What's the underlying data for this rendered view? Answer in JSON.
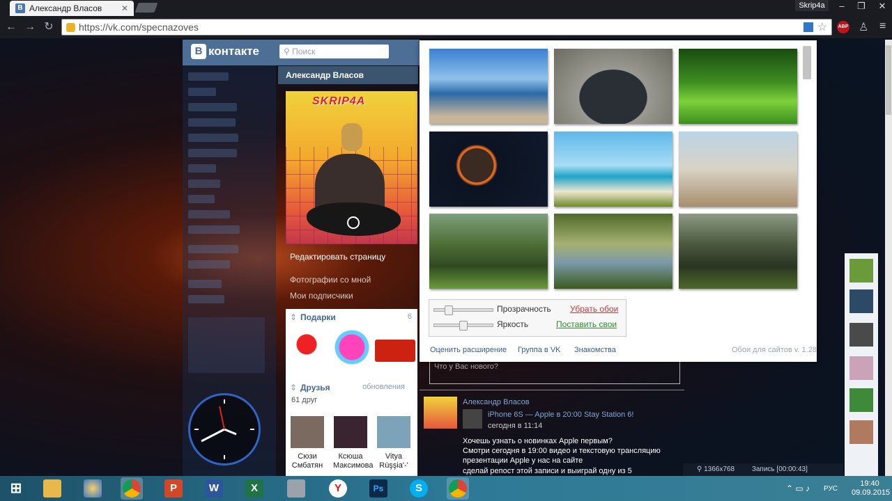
{
  "browser": {
    "tab_title": "Александр Власов",
    "tab_close": "✕",
    "profile_name": "Skrip4a",
    "url": "https://vk.com/specnazoves",
    "abp_label": "ABP",
    "window_controls": [
      "–",
      "❐",
      "✕"
    ]
  },
  "vk": {
    "logo_letter": "В",
    "logo_text": "контакте",
    "search_placeholder": "Поиск",
    "profile_name": "Александр Власов",
    "avatar_watermark": "SKRIP4A",
    "edit_page": "Редактировать страницу",
    "photos_with_me": "Фотографии со мной",
    "subscriptions": "Мои подписчики",
    "gifts": {
      "title": "Подарки",
      "count": "6"
    },
    "friends": {
      "title": "Друзья",
      "updates": "обновления",
      "count_text": "61 друг",
      "list": [
        {
          "first": "Сюзи",
          "last": "Смбатян"
        },
        {
          "first": "Ксюша",
          "last": "Максимова"
        },
        {
          "first": "Vitya",
          "last": "Rùşşia'-'"
        }
      ]
    }
  },
  "popup": {
    "thumbnails": [
      "beach-sea",
      "sports-car",
      "green-park",
      "planet-space",
      "tropical-palm",
      "city-tower",
      "forest-light",
      "forest-lake",
      "forest-dark"
    ],
    "opacity_label": "Прозрачность",
    "brightness_label": "Яркость",
    "opacity_level": 0.2,
    "brightness_level": 0.48,
    "remove_wallpaper": "Убрать обои",
    "set_own": "Поставить свои",
    "rate_extension": "Оценить расширение",
    "vk_group": "Группа в VK",
    "dating": "Знакомства",
    "version": "Обои для сайтов v. 1.28"
  },
  "feed": {
    "author": "Александр Власов",
    "repost_title": "iPhone 6S — Apple в 20:00 Stay Station 6!",
    "time": "сегодня в 11:14",
    "post_question": "Что у Вас нового?",
    "lines": [
      "Хочешь узнать о новинках Apple первым?",
      "Смотри сегодня в 19:00 видео и текстовую трансляцию",
      "презентации Apple у нас на сайте",
      "сделай репост этой записи и выиграй одну из 5"
    ]
  },
  "recorder": {
    "resolution": "1366x768",
    "status": "Запись [00:00:43]"
  },
  "taskbar": {
    "language": "РУС",
    "time": "19:40",
    "date": "09.09.2015",
    "apps": [
      "windows-start",
      "file-explorer",
      "paint",
      "chrome",
      "powerpoint",
      "word",
      "excel",
      "calculator",
      "yandex",
      "photoshop",
      "skype",
      "chrome-2"
    ]
  },
  "colors": {
    "vk_blue": "#4d6f95",
    "link_red": "#c83737",
    "link_green": "#2e8b2e"
  }
}
